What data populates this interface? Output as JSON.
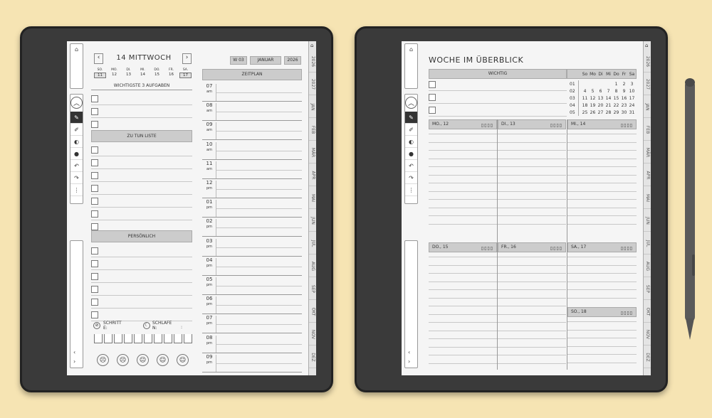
{
  "months": [
    "2026",
    "2027",
    "JAN",
    "FEB",
    "MÄR",
    "APR",
    "MAI",
    "JUN",
    "JUL",
    "AUG",
    "SEP",
    "OKT",
    "NOV",
    "DEZ"
  ],
  "day": {
    "title": "14 MITTWOCH",
    "week": "W 03",
    "month": "JANUAR",
    "year": "2026",
    "weekdays": [
      {
        "d": "SO.",
        "n": "11"
      },
      {
        "d": "MO.",
        "n": "12"
      },
      {
        "d": "DI.",
        "n": "13"
      },
      {
        "d": "MI.",
        "n": "14"
      },
      {
        "d": "DO.",
        "n": "15"
      },
      {
        "d": "FR.",
        "n": "16"
      },
      {
        "d": "SA.",
        "n": "17"
      }
    ],
    "top3": "WICHTIGSTE 3 AUFGABEN",
    "todo": "ZU TUN LISTE",
    "personal": "PERSÖNLICH",
    "schedule": "ZEITPLAN",
    "hours": [
      {
        "h": "07",
        "p": "am"
      },
      {
        "h": "08",
        "p": "am"
      },
      {
        "h": "09",
        "p": "am"
      },
      {
        "h": "10",
        "p": "am"
      },
      {
        "h": "11",
        "p": "am"
      },
      {
        "h": "12",
        "p": "pm"
      },
      {
        "h": "01",
        "p": "pm"
      },
      {
        "h": "02",
        "p": "pm"
      },
      {
        "h": "03",
        "p": "pm"
      },
      {
        "h": "04",
        "p": "pm"
      },
      {
        "h": "05",
        "p": "pm"
      },
      {
        "h": "06",
        "p": "pm"
      },
      {
        "h": "07",
        "p": "pm"
      },
      {
        "h": "08",
        "p": "pm"
      },
      {
        "h": "09",
        "p": "pm"
      }
    ],
    "steps": "SCHRITT E:",
    "sleep": "SCHLAFE N:",
    "colon": ":"
  },
  "week": {
    "title": "WOCHE IM ÜBERBLICK",
    "important": "WICHTIG",
    "cal_head": [
      "So",
      "Mo",
      "Di",
      "Mi",
      "Do",
      "Fr",
      "Sa"
    ],
    "cal_rows": [
      [
        "01",
        "",
        "",
        "",
        "",
        "",
        "1",
        "2",
        "3"
      ],
      [
        "02",
        "4",
        "5",
        "6",
        "7",
        "8",
        "9",
        "10"
      ],
      [
        "03",
        "11",
        "12",
        "13",
        "14",
        "15",
        "16",
        "17"
      ],
      [
        "04",
        "18",
        "19",
        "20",
        "21",
        "22",
        "23",
        "24"
      ],
      [
        "05",
        "25",
        "26",
        "27",
        "28",
        "29",
        "30",
        "31"
      ]
    ],
    "days": [
      "MO., 12",
      "DI., 13",
      "MI., 14",
      "DO., 15",
      "FR., 16",
      "SA., 17",
      "SO., 18"
    ]
  },
  "icons": [
    "home-icon",
    "chevron-up-icon",
    "pen-icon",
    "marker-icon",
    "eraser-icon",
    "lasso-icon",
    "undo-icon",
    "redo-icon",
    "more-icon",
    "chevron-left-icon",
    "chevron-right-icon"
  ]
}
